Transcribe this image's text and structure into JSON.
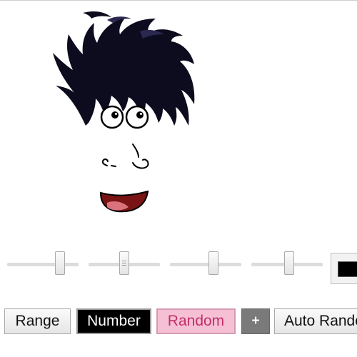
{
  "sliders": [
    {
      "name": "slider-1",
      "value": 0.78
    },
    {
      "name": "slider-2",
      "value": 0.5
    },
    {
      "name": "slider-3",
      "value": 0.63
    },
    {
      "name": "slider-4",
      "value": 0.54
    }
  ],
  "color_picker": {
    "value": "#000000"
  },
  "buttons": {
    "range": "Range",
    "number": "Number",
    "random": "Random",
    "plus": "+",
    "auto_random": "Auto Random"
  },
  "colors": {
    "hair": "#0d0b1e",
    "mouth": "#7a1414",
    "tongue": "#d9727a",
    "accent_pink": "#f6c0d4",
    "accent_pink_text": "#c0306a"
  }
}
